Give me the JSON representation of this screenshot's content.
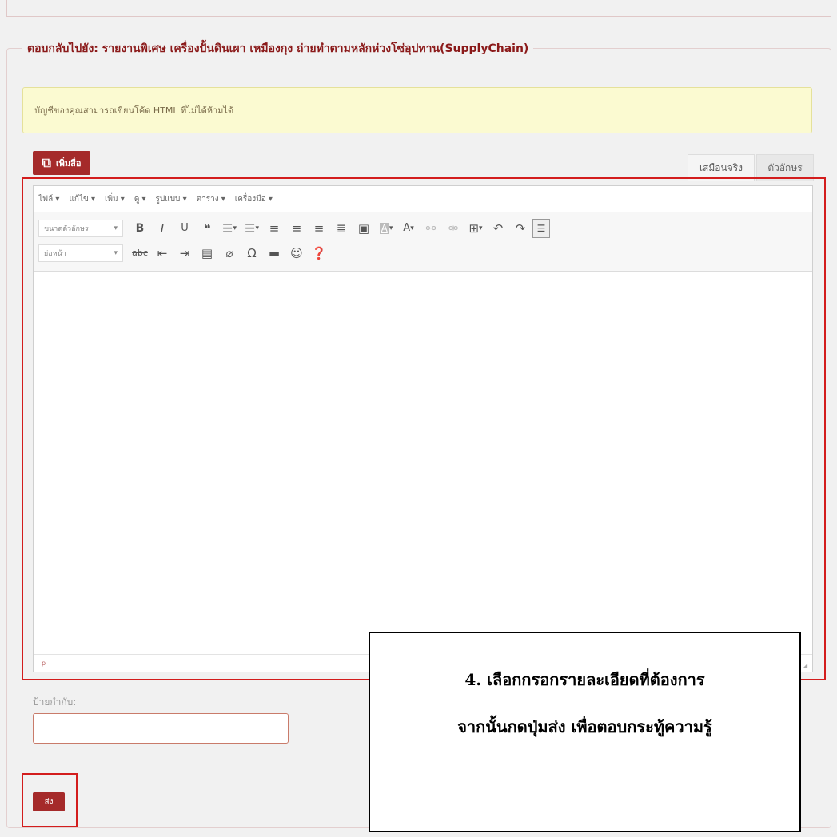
{
  "reply_section": {
    "legend": "ตอบกลับไปยัง: รายงานพิเศษ เครื่องปั้นดินเผา เหมืองกุง ถ่ายทำตามหลักห่วงโซ่อุปทาน(SupplyChain)",
    "notice": "บัญชีของคุณสามารถเขียนโค้ด HTML ที่ไม่ได้ห้ามได้"
  },
  "editor": {
    "add_media_label": "เพิ่มสื่อ",
    "tabs": {
      "visual": "เสมือนจริง",
      "text": "ตัวอักษร"
    },
    "menu": [
      "ไฟล์ ▾",
      "แก้ไข ▾",
      "เพิ่ม ▾",
      "ดู ▾",
      "รูปแบบ ▾",
      "ตาราง ▾",
      "เครื่องมือ ▾"
    ],
    "font_size_select": "ขนาดตัวอักษร",
    "paragraph_select": "ย่อหน้า",
    "path": "p"
  },
  "form": {
    "tags_label": "ป้ายกำกับ:",
    "tags_value": "",
    "submit_label": "ส่ง"
  },
  "callout": {
    "line1": "4. เลือกกรอกรายละเอียดที่ต้องการ",
    "line2": "จากนั้นกดปุ่มส่ง เพื่อตอบกระทู้ความรู้"
  },
  "icons": {
    "row1": [
      "bold-icon",
      "italic-icon",
      "underline-icon",
      "blockquote-icon",
      "bullet-list-icon",
      "numbered-list-icon",
      "align-left-icon",
      "align-center-icon",
      "align-right-icon",
      "align-justify-icon",
      "image-icon",
      "background-color-icon",
      "text-color-icon",
      "link-icon",
      "unlink-icon",
      "table-icon",
      "undo-icon",
      "redo-icon",
      "toolbar-toggle-icon"
    ],
    "row2": [
      "strikethrough-icon",
      "outdent-icon",
      "indent-icon",
      "paste-text-icon",
      "clear-format-icon",
      "special-char-icon",
      "horizontal-rule-icon",
      "emoticon-icon",
      "help-icon"
    ]
  },
  "colors": {
    "accent": "#a52a2a",
    "highlight": "#d31d1d",
    "notice_bg": "#fbfad1"
  }
}
